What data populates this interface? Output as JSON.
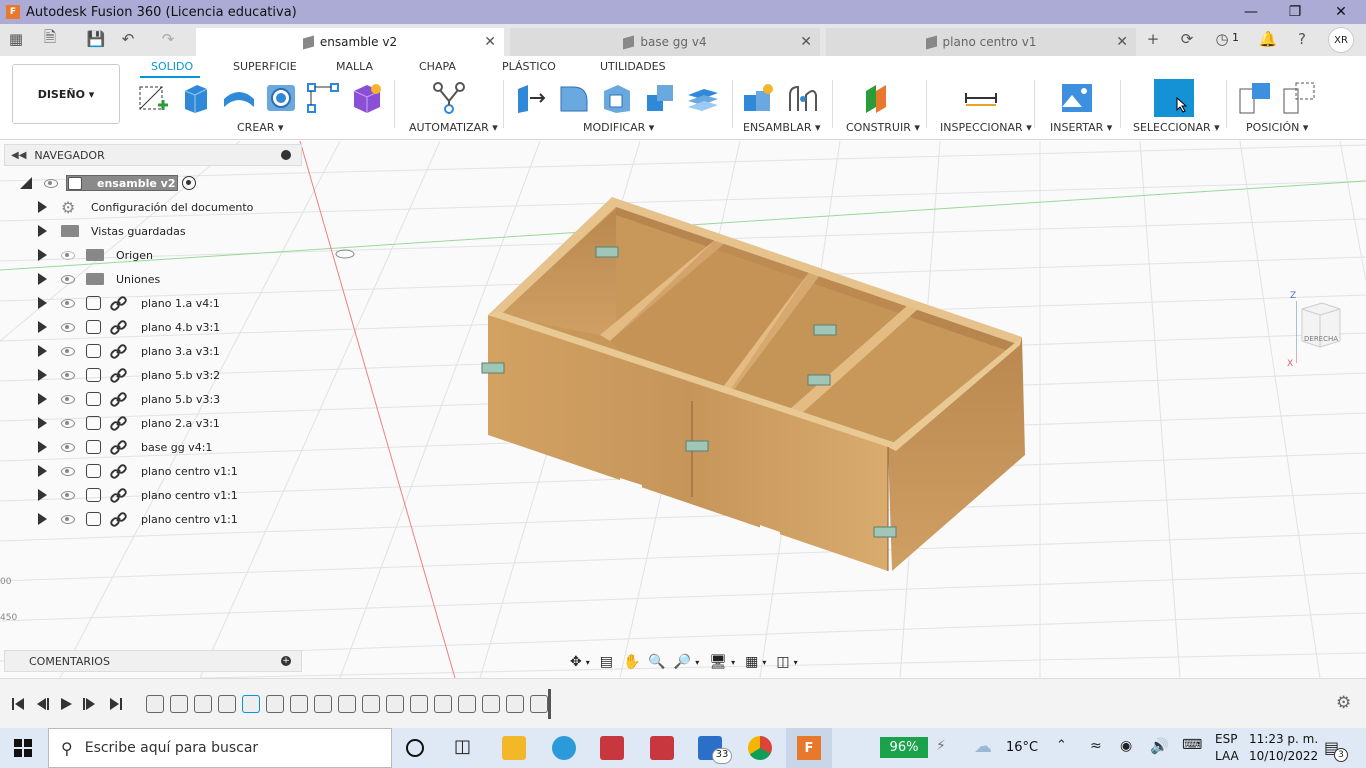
{
  "window": {
    "title": "Autodesk Fusion 360 (Licencia educativa)",
    "logo": "F"
  },
  "tabs": [
    {
      "label": "ensamble v2",
      "active": true
    },
    {
      "label": "base gg v4",
      "active": false
    },
    {
      "label": "plano centro v1",
      "active": false
    }
  ],
  "tab_bar": {
    "notifications_count": "1",
    "user_initials": "XR"
  },
  "toolbar": {
    "workspace": "DISEÑO",
    "ribbon_tabs": [
      "SOLIDO",
      "SUPERFICIE",
      "MALLA",
      "CHAPA",
      "PLÁSTICO",
      "UTILIDADES"
    ],
    "groups": [
      "CREAR",
      "AUTOMATIZAR",
      "MODIFICAR",
      "ENSAMBLAR",
      "CONSTRUIR",
      "INSPECCIONAR",
      "INSERTAR",
      "SELECCIONAR",
      "POSICIÓN"
    ]
  },
  "browser": {
    "header": "NAVEGADOR",
    "root": "ensamble v2",
    "items": [
      {
        "label": "Configuración del documento",
        "type": "settings"
      },
      {
        "label": "Vistas guardadas",
        "type": "folder"
      },
      {
        "label": "Origen",
        "type": "folder",
        "hidden": true
      },
      {
        "label": "Uniones",
        "type": "folder"
      },
      {
        "label": "plano 1.a v4:1",
        "type": "component"
      },
      {
        "label": "plano 4.b v3:1",
        "type": "component"
      },
      {
        "label": "plano 3.a v3:1",
        "type": "component"
      },
      {
        "label": "plano 5.b v3:2",
        "type": "component"
      },
      {
        "label": "plano 5.b v3:3",
        "type": "component"
      },
      {
        "label": "plano 2.a v3:1",
        "type": "component"
      },
      {
        "label": "base gg v4:1",
        "type": "component"
      },
      {
        "label": "plano centro v1:1",
        "type": "component"
      },
      {
        "label": "plano centro v1:1",
        "type": "component"
      },
      {
        "label": "plano centro v1:1",
        "type": "component"
      }
    ]
  },
  "viewcube": {
    "face_label": "DERECHA",
    "axis_z": "Z",
    "axis_x": "X"
  },
  "ruler_marks": [
    "00",
    "450"
  ],
  "comments": {
    "label": "COMENTARIOS"
  },
  "taskbar": {
    "search_placeholder": "Escribe aquí para buscar",
    "mail_count": "33",
    "battery": "96%",
    "temperature": "16°C",
    "lang_top": "ESP",
    "lang_bottom": "LAA",
    "time": "11:23 p. m.",
    "date": "10/10/2022",
    "notif_count": "3"
  },
  "colors": {
    "accent": "#0696d7",
    "title_bar": "#ababd6",
    "wood": "#cfa066"
  }
}
